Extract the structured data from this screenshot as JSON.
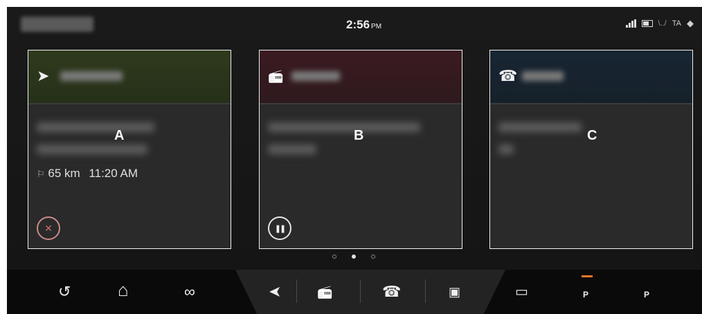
{
  "status": {
    "time": "2:56",
    "ampm": "PM",
    "indicators": [
      "signal-icon",
      "battery-icon",
      "TA",
      "wifi-icon"
    ],
    "ta_label": "TA",
    "wifi_glyph": "◆"
  },
  "cards": [
    {
      "id": "A",
      "letter": "A",
      "icon": "navigation-arrow-icon",
      "icon_glyph": "➤",
      "accent": "#3b4a1e",
      "distance_glyph": "⚐",
      "distance": "65 km",
      "eta": "11:20 AM",
      "button_icon": "mute-guidance-icon",
      "button_glyph": "✕"
    },
    {
      "id": "B",
      "letter": "B",
      "icon": "radio-icon",
      "icon_glyph": "📻",
      "accent": "#4a1a22",
      "button_icon": "pause-icon",
      "button_glyph": "❚❚"
    },
    {
      "id": "C",
      "letter": "C",
      "icon": "phone-icon",
      "icon_glyph": "☎",
      "accent": "#1a2a36"
    }
  ],
  "page_dots": 3,
  "active_dot": 1,
  "bottom_bar": {
    "back_glyph": "↺",
    "home_glyph": "⌂",
    "connect_glyph": "∞",
    "nav_glyph": "➤",
    "radio_glyph": "📻",
    "phone_glyph": "☎",
    "apps_glyph": "▣",
    "camera_glyph": "▭",
    "parking_label": "P",
    "parking_assist_label": "P"
  },
  "colors": {
    "background": "#141414",
    "card_border": "#f2f2f2",
    "parking_accent": "#e8782a"
  }
}
